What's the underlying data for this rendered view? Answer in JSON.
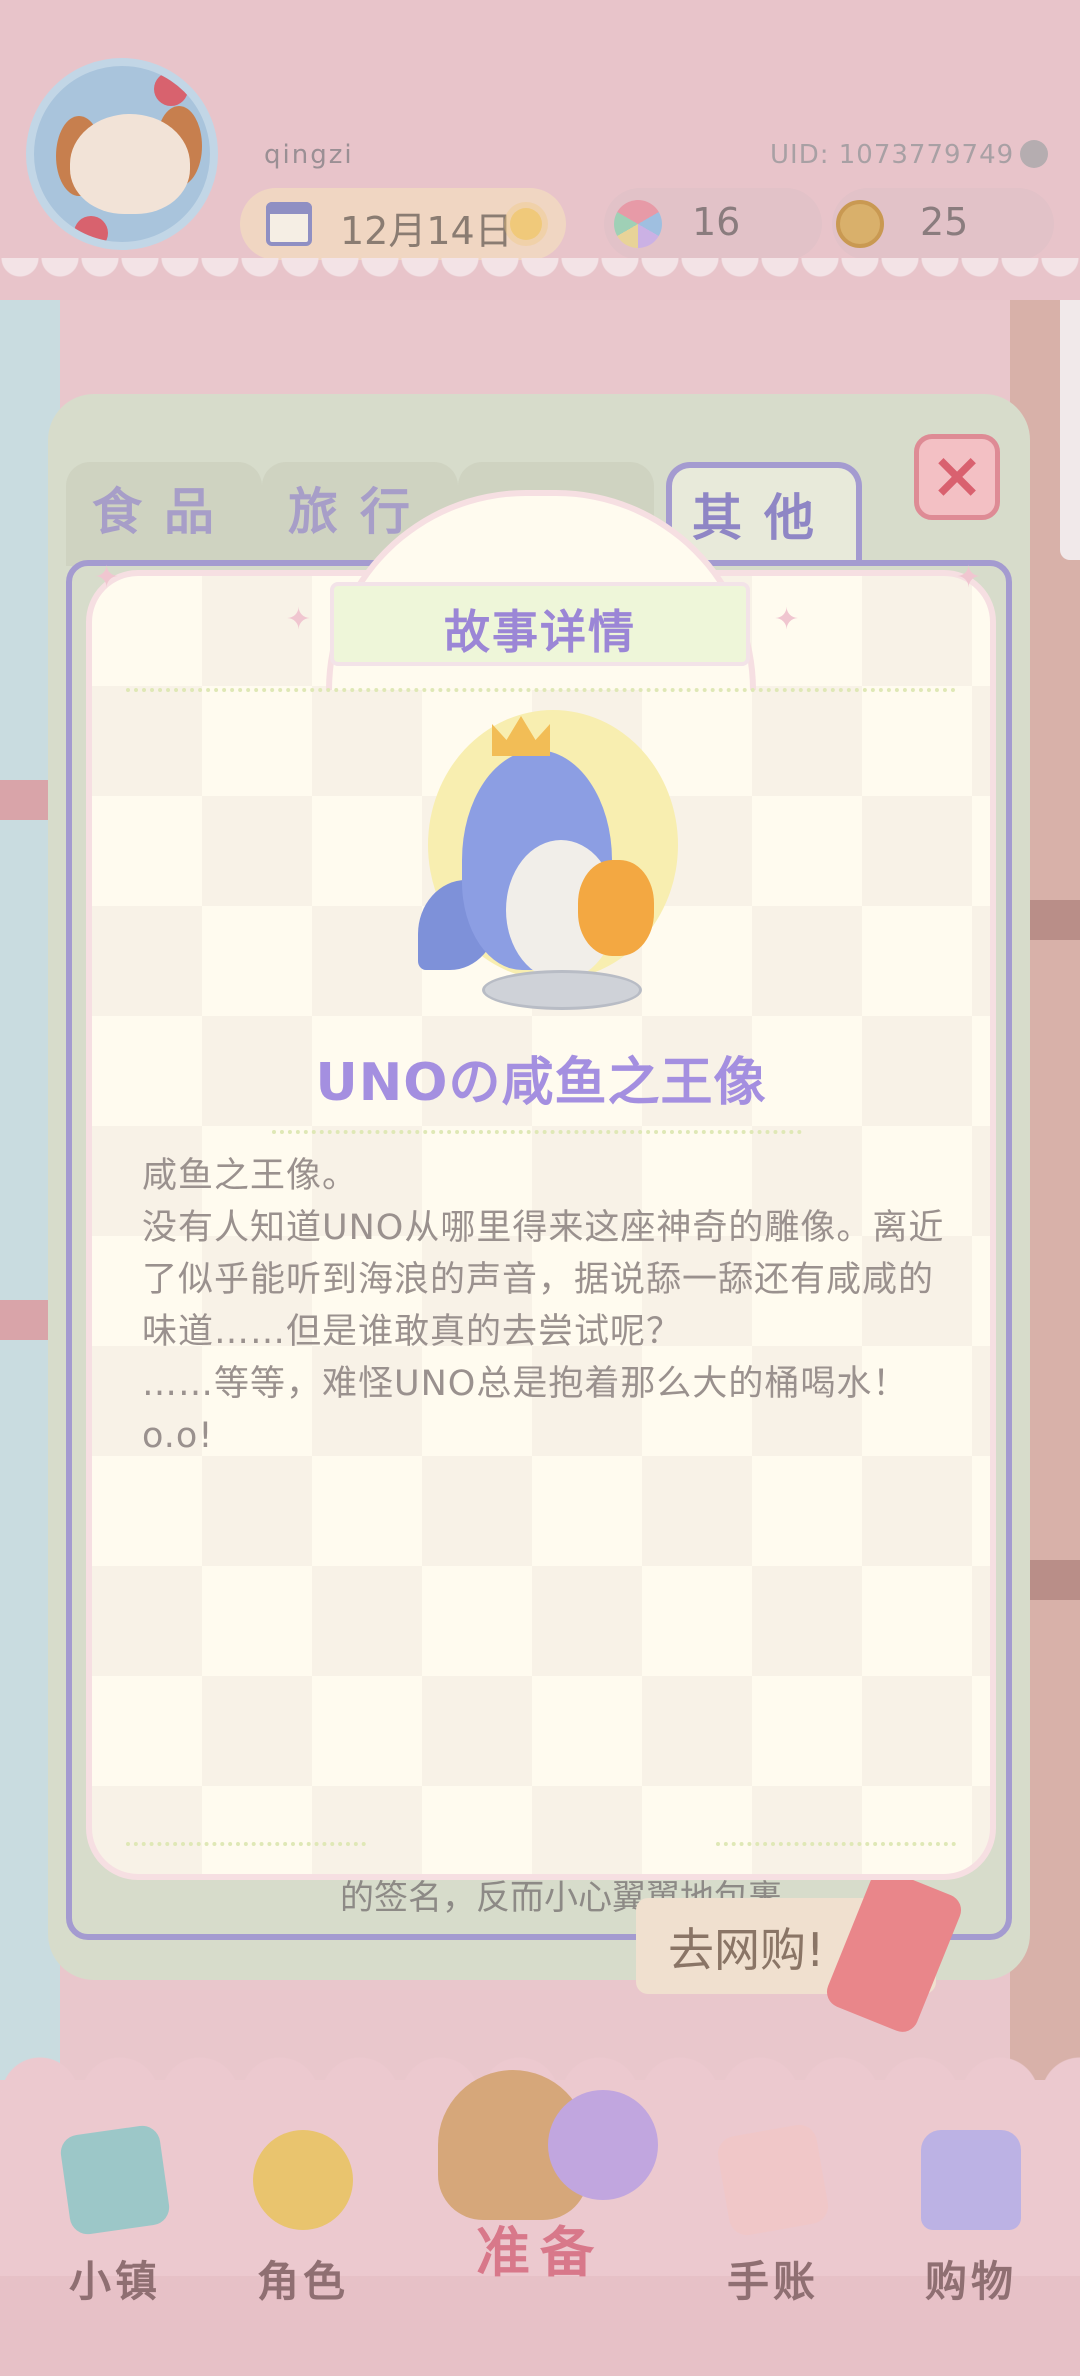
{
  "header": {
    "username": "qingzi",
    "uid": "UID: 1073779749",
    "date": "12月14日",
    "gems": "16",
    "coins": "25"
  },
  "shop": {
    "tabs": [
      "食品",
      "旅行",
      "",
      "其他"
    ],
    "active_tab": "其他",
    "go_shopping_label": "去网购!",
    "row_text": "的签名，反而小心翼翼地包裹..."
  },
  "story_dialog": {
    "title": "故事详情",
    "item_name": "UNOの咸鱼之王像",
    "description": "咸鱼之王像。\n没有人知道UNO从哪里得来这座神奇的雕像。离近了似乎能听到海浪的声音，据说舔一舔还有咸咸的味道……但是谁敢真的去尝试呢？\n……等等，难怪UNO总是抱着那么大的桶喝水！o.o!"
  },
  "bottom_nav": {
    "town": "小镇",
    "role": "角色",
    "prepare": "准备",
    "diary": "手账",
    "shopping": "购物"
  },
  "colors": {
    "accent_purple": "#a48fe0",
    "close_red": "#d9616f",
    "card_bg": "#fffbef"
  },
  "icons": [
    "avatar",
    "calendar-icon",
    "sun-icon",
    "gem-icon",
    "coin-icon",
    "copy-icon",
    "close-icon",
    "map-icon",
    "character-icon",
    "basket-icon",
    "journal-icon",
    "shopping-bag-icon"
  ]
}
